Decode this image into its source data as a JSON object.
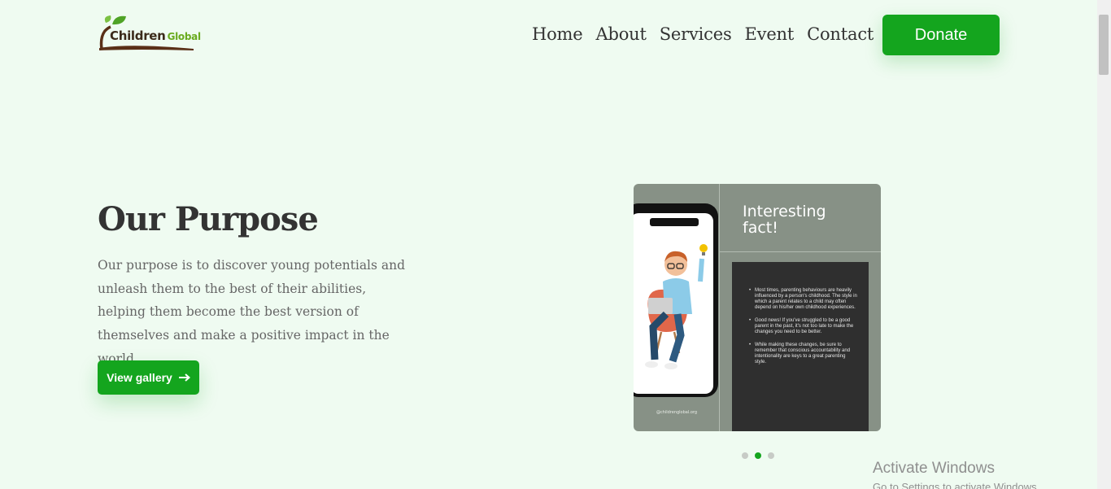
{
  "logo": {
    "word1": "Children",
    "word2": "Global"
  },
  "nav": {
    "items": [
      "Home",
      "About",
      "Services",
      "Event",
      "Contact"
    ]
  },
  "donate_label": "Donate",
  "hero": {
    "title": "Our Purpose",
    "description": "Our purpose is to discover young potentials and unleash them to the best of their abilities, helping them become the best version of themselves and make a positive impact in the world.",
    "button_label": "View gallery",
    "button_icon": "arrow-right-icon"
  },
  "slide": {
    "title_line1": "Interesting",
    "title_line2": "fact!",
    "bullets": [
      "Most times, parenting behaviours are heavily influenced by a person's childhood. The style in which a parent relates to a child may often depend on his/her own childhood experiences.",
      "Good news! If you've struggled to be a good parent in the past, it's not too late to make the changes you need to be better.",
      "While making these changes, be sure to remember that conscious accountability and intentionality are keys to a great parenting style."
    ],
    "handle": "@childrenglobal.org"
  },
  "carousel": {
    "slide_count": 3,
    "active_index": 1
  },
  "watermark": {
    "line1": "Activate Windows",
    "line2": "Go to Settings to activate Windows."
  },
  "colors": {
    "background": "#effbf1",
    "accent": "#14a51e",
    "card": "#879186",
    "fact_box": "#2f2f2f"
  }
}
